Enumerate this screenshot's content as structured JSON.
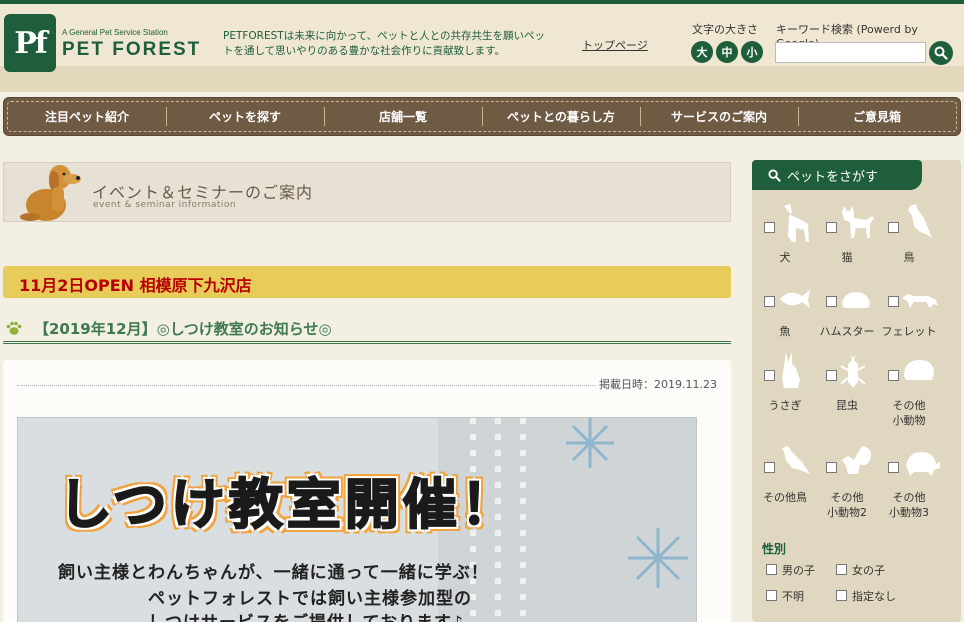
{
  "header": {
    "logo_mark": "Pf",
    "logo_sub": "A General Pet Service Station",
    "logo_main": "PET FOREST",
    "tagline": "PETFORESTは未来に向かって、ペットと人との共存共生を願いペットを通して思いやりのある豊かな社会作りに貢献致します。",
    "top_link": "トップページ",
    "font_size_label": "文字の大きさ",
    "font_sizes": [
      "大",
      "中",
      "小"
    ],
    "search_label": "キーワード検索 (Powerd by Google)",
    "search_value": ""
  },
  "nav": {
    "items": [
      "注目ペット紹介",
      "ペットを探す",
      "店舗一覧",
      "ペットとの暮らし方",
      "サービスのご案内",
      "ご意見箱"
    ]
  },
  "event": {
    "title": "イベント＆セミナーのご案内",
    "subtitle": "event & seminar information"
  },
  "announcement": "11月2日OPEN 相模原下九沢店",
  "post": {
    "title": "【2019年12月】◎しつけ教室のお知らせ◎",
    "date": "掲載日時：2019.11.23",
    "poster_title": "しつけ教室開催！",
    "poster_lines": [
      "飼い主様とわんちゃんが、一緒に通って一緒に学ぶ！",
      "ペットフォレストでは飼い主様参加型の",
      "しつけサービスをご提供しております♪"
    ]
  },
  "sidebar": {
    "header": "ペットをさがす",
    "pets": [
      {
        "label": "犬",
        "icon": "dog-icon"
      },
      {
        "label": "猫",
        "icon": "cat-icon"
      },
      {
        "label": "鳥",
        "icon": "bird-icon"
      },
      {
        "label": "魚",
        "icon": "fish-icon"
      },
      {
        "label": "ハムスター",
        "icon": "hamster-icon"
      },
      {
        "label": "フェレット",
        "icon": "ferret-icon"
      },
      {
        "label": "うさぎ",
        "icon": "rabbit-icon"
      },
      {
        "label": "昆虫",
        "icon": "beetle-icon"
      },
      {
        "label": "その他\n小動物",
        "icon": "small-animal-icon"
      },
      {
        "label": "その他鳥",
        "icon": "other-bird-icon"
      },
      {
        "label": "その他\n小動物2",
        "icon": "squirrel-icon"
      },
      {
        "label": "その他\n小動物3",
        "icon": "turtle-icon"
      }
    ],
    "gender_title": "性別",
    "genders": [
      "男の子",
      "女の子",
      "不明",
      "指定なし"
    ]
  },
  "colors": {
    "brand_green": "#1e5e3a",
    "nav_brown": "#6f5a44",
    "announce_yellow": "#e8cc5a",
    "announce_red": "#b80000"
  }
}
